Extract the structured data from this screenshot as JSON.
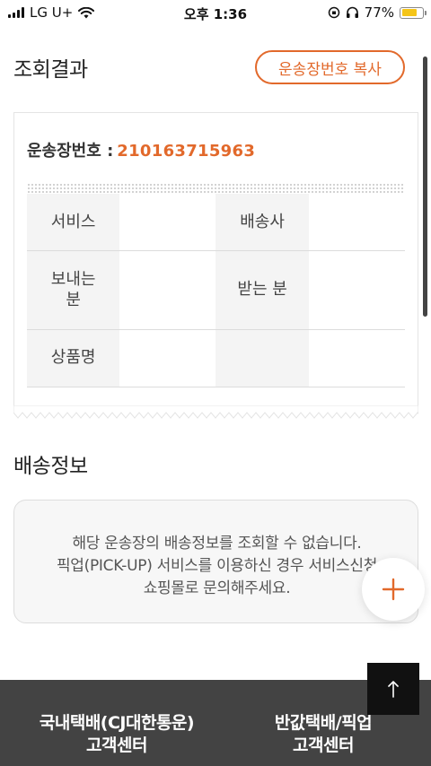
{
  "status_bar": {
    "carrier": "LG U+",
    "time": "오후 1:36",
    "battery_percent": "77%",
    "battery_level": 0.77,
    "battery_color": "#f5c518"
  },
  "result": {
    "title": "조회결과",
    "copy_button_label": "운송장번호 복사",
    "tracking_label": "운송장번호 :",
    "tracking_number": "210163715963",
    "table": [
      [
        {
          "label": "서비스",
          "value": ""
        },
        {
          "label": "배송사",
          "value": ""
        }
      ],
      [
        {
          "label": "보내는 분",
          "value": ""
        },
        {
          "label": "받는 분",
          "value": ""
        }
      ],
      [
        {
          "label": "상품명",
          "value": ""
        },
        {
          "label": "",
          "value": ""
        }
      ]
    ]
  },
  "delivery": {
    "title": "배송정보",
    "notice_lines": [
      "해당 운송장의 배송정보를 조회할 수 없습니다.",
      "픽업(PICK-UP) 서비스를 이용하신 경우 서비스신청",
      "쇼핑몰로 문의해주세요."
    ]
  },
  "icons": {
    "plus": "plus-icon",
    "scroll_top": "arrow-up-icon"
  },
  "footer": {
    "items": [
      {
        "line1": "국내택배(CJ대한통운)",
        "line2": "고객센터"
      },
      {
        "line1": "반값택배/픽업",
        "line2": "고객센터"
      }
    ]
  },
  "colors": {
    "accent": "#e2692b",
    "footer_bg": "#434343"
  }
}
